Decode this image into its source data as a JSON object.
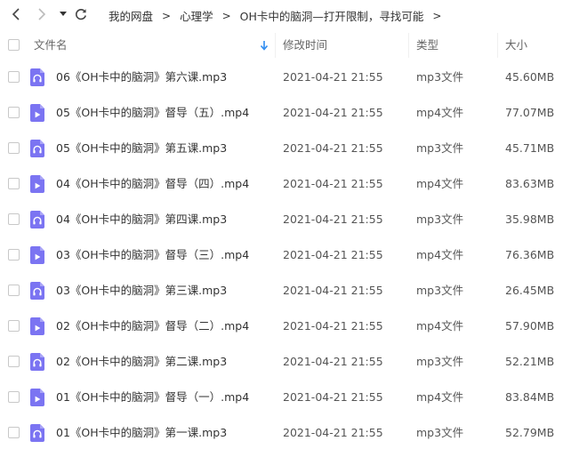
{
  "nav": {
    "back_icon": "chevron-left-icon",
    "forward_icon": "chevron-right-icon",
    "dropdown_icon": "caret-down-icon",
    "refresh_icon": "refresh-icon"
  },
  "breadcrumb": {
    "items": [
      "我的网盘",
      "心理学",
      "OH卡中的脑洞—打开限制，寻找可能"
    ],
    "separator": ">"
  },
  "columns": {
    "name": "文件名",
    "modified": "修改时间",
    "type": "类型",
    "size": "大小"
  },
  "colors": {
    "accent": "#2f8cf0",
    "file_icon": "#7b74f2",
    "border": "#f0f0f0"
  },
  "files": [
    {
      "name": "06《OH卡中的脑洞》第六课.mp3",
      "modified": "2021-04-21 21:55",
      "type": "mp3文件",
      "size": "45.60MB",
      "icon": "audio-file-icon"
    },
    {
      "name": "05《OH卡中的脑洞》督导（五）.mp4",
      "modified": "2021-04-21 21:55",
      "type": "mp4文件",
      "size": "77.07MB",
      "icon": "video-file-icon"
    },
    {
      "name": "05《OH卡中的脑洞》第五课.mp3",
      "modified": "2021-04-21 21:55",
      "type": "mp3文件",
      "size": "45.71MB",
      "icon": "audio-file-icon"
    },
    {
      "name": "04《OH卡中的脑洞》督导（四）.mp4",
      "modified": "2021-04-21 21:55",
      "type": "mp4文件",
      "size": "83.63MB",
      "icon": "video-file-icon"
    },
    {
      "name": "04《OH卡中的脑洞》第四课.mp3",
      "modified": "2021-04-21 21:55",
      "type": "mp3文件",
      "size": "35.98MB",
      "icon": "audio-file-icon"
    },
    {
      "name": "03《OH卡中的脑洞》督导（三）.mp4",
      "modified": "2021-04-21 21:55",
      "type": "mp4文件",
      "size": "76.36MB",
      "icon": "video-file-icon"
    },
    {
      "name": "03《OH卡中的脑洞》第三课.mp3",
      "modified": "2021-04-21 21:55",
      "type": "mp3文件",
      "size": "26.45MB",
      "icon": "audio-file-icon"
    },
    {
      "name": "02《OH卡中的脑洞》督导（二）.mp4",
      "modified": "2021-04-21 21:55",
      "type": "mp4文件",
      "size": "57.90MB",
      "icon": "video-file-icon"
    },
    {
      "name": "02《OH卡中的脑洞》第二课.mp3",
      "modified": "2021-04-21 21:55",
      "type": "mp3文件",
      "size": "52.21MB",
      "icon": "audio-file-icon"
    },
    {
      "name": "01《OH卡中的脑洞》督导（一）.mp4",
      "modified": "2021-04-21 21:55",
      "type": "mp4文件",
      "size": "83.84MB",
      "icon": "video-file-icon"
    },
    {
      "name": "01《OH卡中的脑洞》第一课.mp3",
      "modified": "2021-04-21 21:55",
      "type": "mp3文件",
      "size": "52.79MB",
      "icon": "audio-file-icon"
    }
  ]
}
